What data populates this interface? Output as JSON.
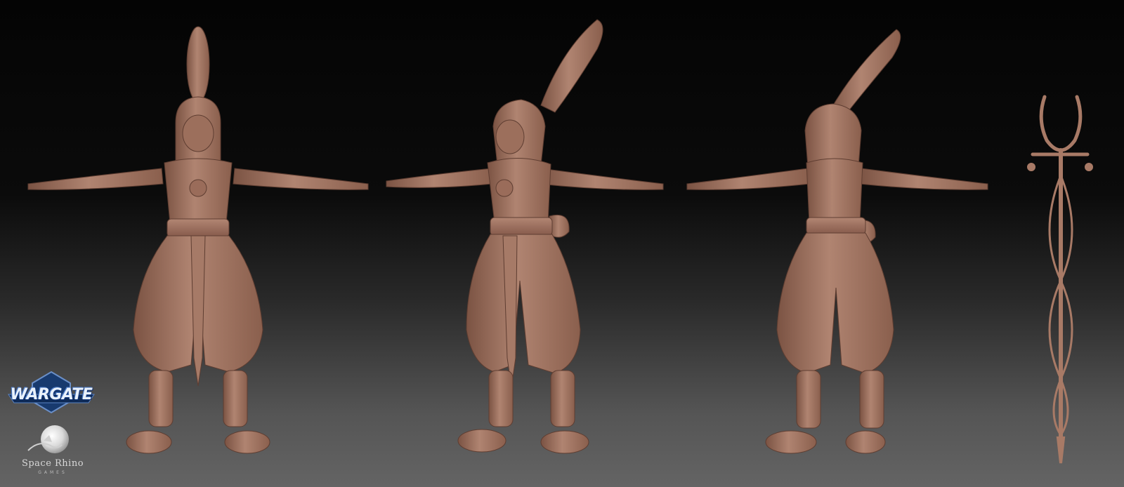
{
  "logos": {
    "wargate": {
      "text": "WARGATE"
    },
    "space_rhino": {
      "name": "Space Rhino",
      "sub": "GAMES"
    }
  },
  "colors": {
    "clay": "#a87a66",
    "clay_shadow": "#6e4a3c",
    "clay_highlight": "#c79a86"
  }
}
